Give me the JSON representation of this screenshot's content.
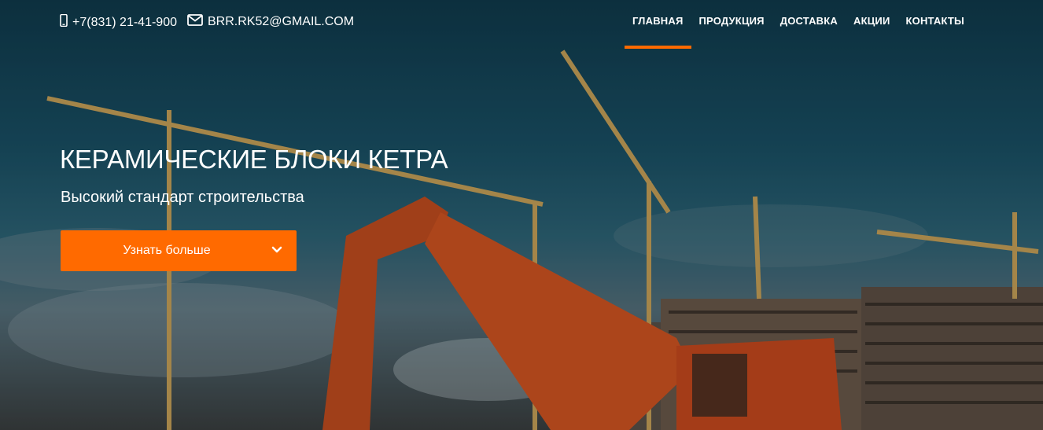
{
  "header": {
    "phone": "+7(831) 21-41-900",
    "email": "BRR.RK52@GMAIL.COM",
    "icons": {
      "phone": "phone-icon",
      "email": "envelope-icon"
    }
  },
  "nav": {
    "items": [
      {
        "label": "ГЛАВНАЯ",
        "active": true
      },
      {
        "label": "ПРОДУКЦИЯ",
        "active": false
      },
      {
        "label": "ДОСТАВКА",
        "active": false
      },
      {
        "label": "АКЦИИ",
        "active": false
      },
      {
        "label": "КОНТАКТЫ",
        "active": false
      }
    ]
  },
  "hero": {
    "title": "КЕРАМИЧЕСКИЕ БЛОКИ КЕТРА",
    "subtitle": "Высокий стандарт строительства",
    "cta_label": "Узнать больше",
    "cta_icon": "chevron-down-icon"
  },
  "colors": {
    "accent": "#ff6a00",
    "text": "#ffffff"
  }
}
